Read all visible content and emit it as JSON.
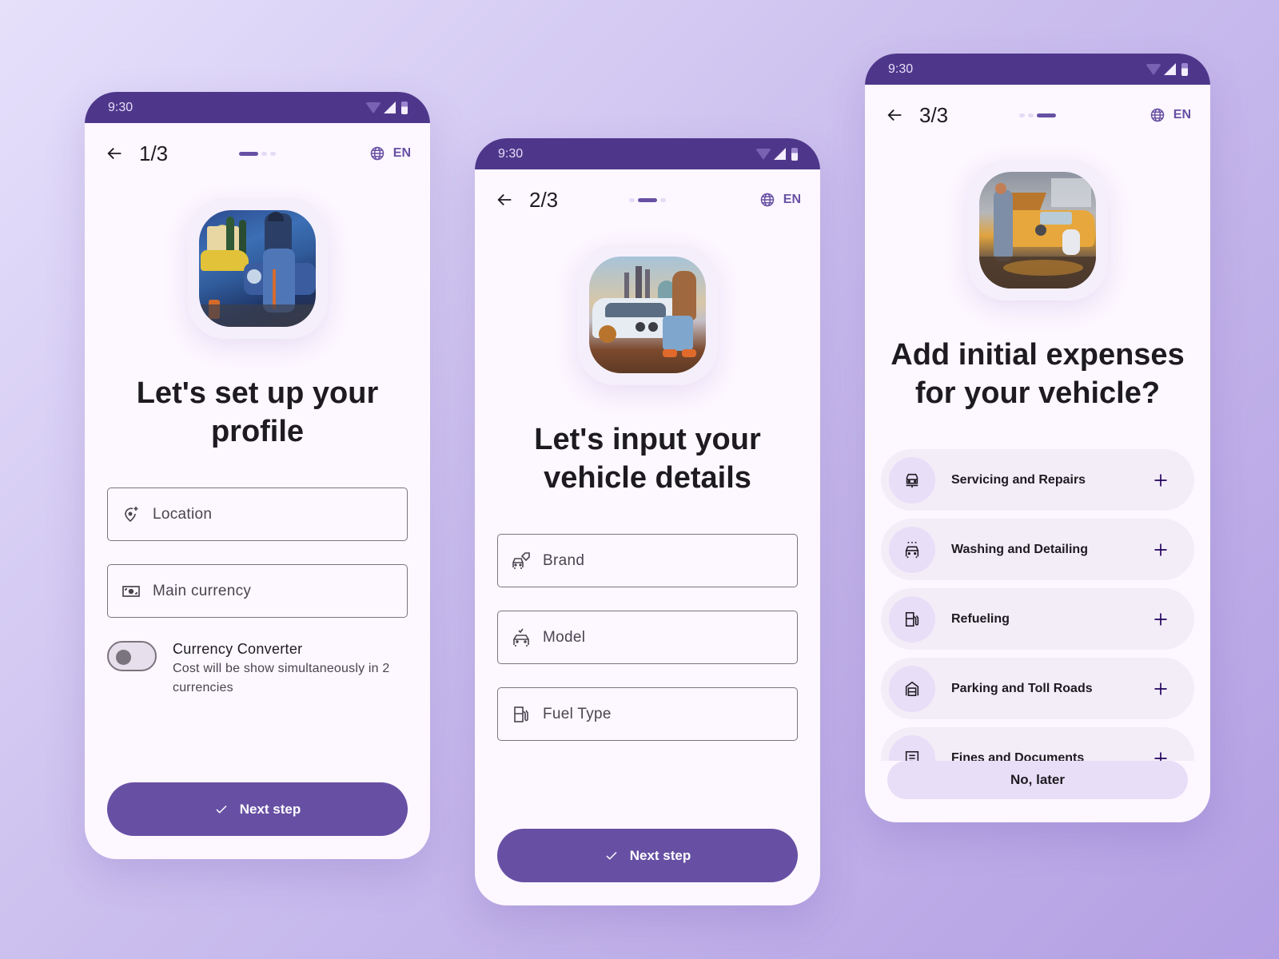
{
  "colors": {
    "primary": "#6750a4",
    "status_bar": "#4e378b",
    "surface": "#fdf7ff",
    "tonal": "#e8def8"
  },
  "screens": [
    {
      "status_time": "9:30",
      "step": "1/3",
      "step_index": 1,
      "step_total": 3,
      "language": "EN",
      "hero_image": "mechanic-painting-illustration",
      "title_line1": "Let's set up your",
      "title_line2": "profile",
      "fields": [
        {
          "icon": "add-location-icon",
          "placeholder": "Location",
          "value": ""
        },
        {
          "icon": "money-icon",
          "placeholder": "Main currency",
          "value": ""
        }
      ],
      "toggle": {
        "title": "Currency Converter",
        "subtitle": "Cost will be show simultaneously in 2 currencies",
        "on": false
      },
      "primary_button": "Next step"
    },
    {
      "status_time": "9:30",
      "step": "2/3",
      "step_index": 2,
      "step_total": 3,
      "language": "EN",
      "hero_image": "car-and-person-city-illustration",
      "title_line1": "Let's input your",
      "title_line2": "vehicle details",
      "fields": [
        {
          "icon": "car-tag-icon",
          "placeholder": "Brand",
          "value": ""
        },
        {
          "icon": "car-check-icon",
          "placeholder": "Model",
          "value": ""
        },
        {
          "icon": "fuel-pump-icon",
          "placeholder": "Fuel Type",
          "value": ""
        }
      ],
      "primary_button": "Next step"
    },
    {
      "status_time": "9:30",
      "step": "3/3",
      "step_index": 3,
      "step_total": 3,
      "language": "EN",
      "hero_image": "garage-mechanics-illustration",
      "title_line1": "Add initial expenses",
      "title_line2": "for your vehicle?",
      "expense_categories": [
        {
          "icon": "car-repair-icon",
          "label": "Servicing and Repairs"
        },
        {
          "icon": "car-wash-icon",
          "label": "Washing and Detailing"
        },
        {
          "icon": "fuel-pump-icon",
          "label": "Refueling"
        },
        {
          "icon": "garage-icon",
          "label": "Parking and Toll Roads"
        },
        {
          "icon": "document-icon",
          "label": "Fines and Documents"
        }
      ],
      "secondary_button": "No, later"
    }
  ]
}
